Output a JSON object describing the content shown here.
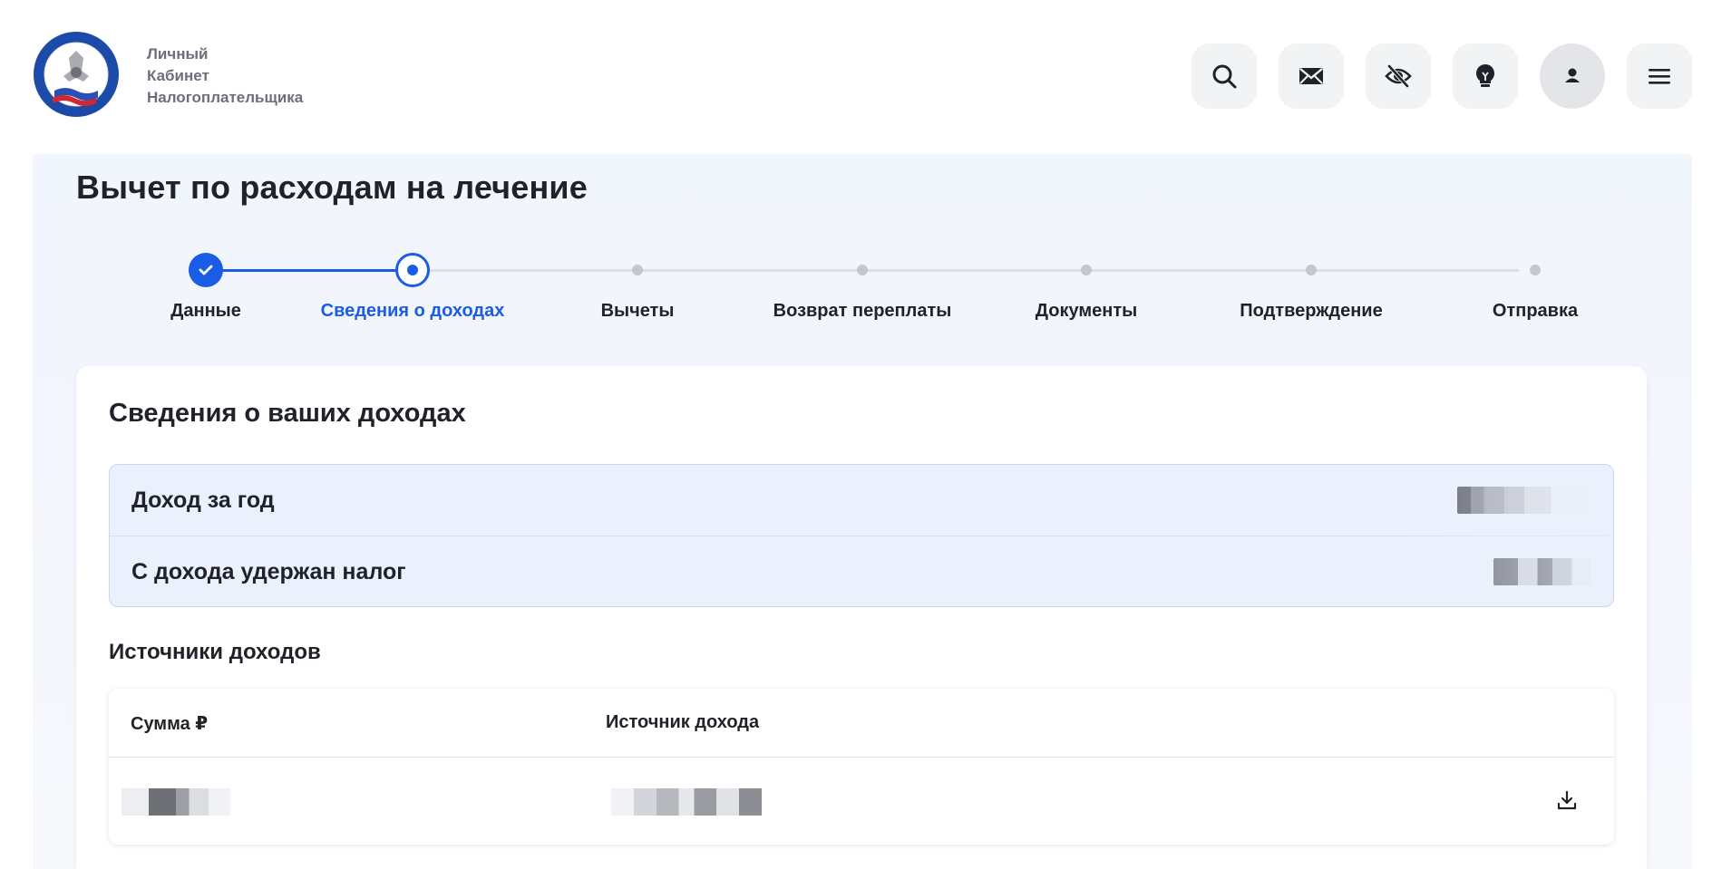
{
  "brand": {
    "line1": "Личный",
    "line2": "Кабинет",
    "line3": "Налогоплательщика"
  },
  "header_actions": [
    {
      "name": "search-icon"
    },
    {
      "name": "mail-icon"
    },
    {
      "name": "eye-off-icon"
    },
    {
      "name": "lightbulb-icon"
    },
    {
      "name": "user-icon"
    },
    {
      "name": "menu-icon"
    }
  ],
  "page": {
    "title": "Вычет по расходам на лечение"
  },
  "stepper": {
    "steps": [
      {
        "label": "Данные",
        "state": "done"
      },
      {
        "label": "Сведения о доходах",
        "state": "current"
      },
      {
        "label": "Вычеты",
        "state": "todo"
      },
      {
        "label": "Возврат переплаты",
        "state": "todo"
      },
      {
        "label": "Документы",
        "state": "todo"
      },
      {
        "label": "Подтверждение",
        "state": "todo"
      },
      {
        "label": "Отправка",
        "state": "todo"
      }
    ]
  },
  "card": {
    "title": "Сведения о ваших доходах",
    "summary": {
      "income_label": "Доход за год",
      "tax_label": "С дохода удержан налог"
    },
    "sources_title": "Источники доходов",
    "table": {
      "headers": [
        "Сумма ₽",
        "Источник дохода"
      ]
    }
  },
  "colors": {
    "accent": "#1a5ce5",
    "step_inactive": "#c4c7cd",
    "summary_bg": "#eaf0fc"
  }
}
